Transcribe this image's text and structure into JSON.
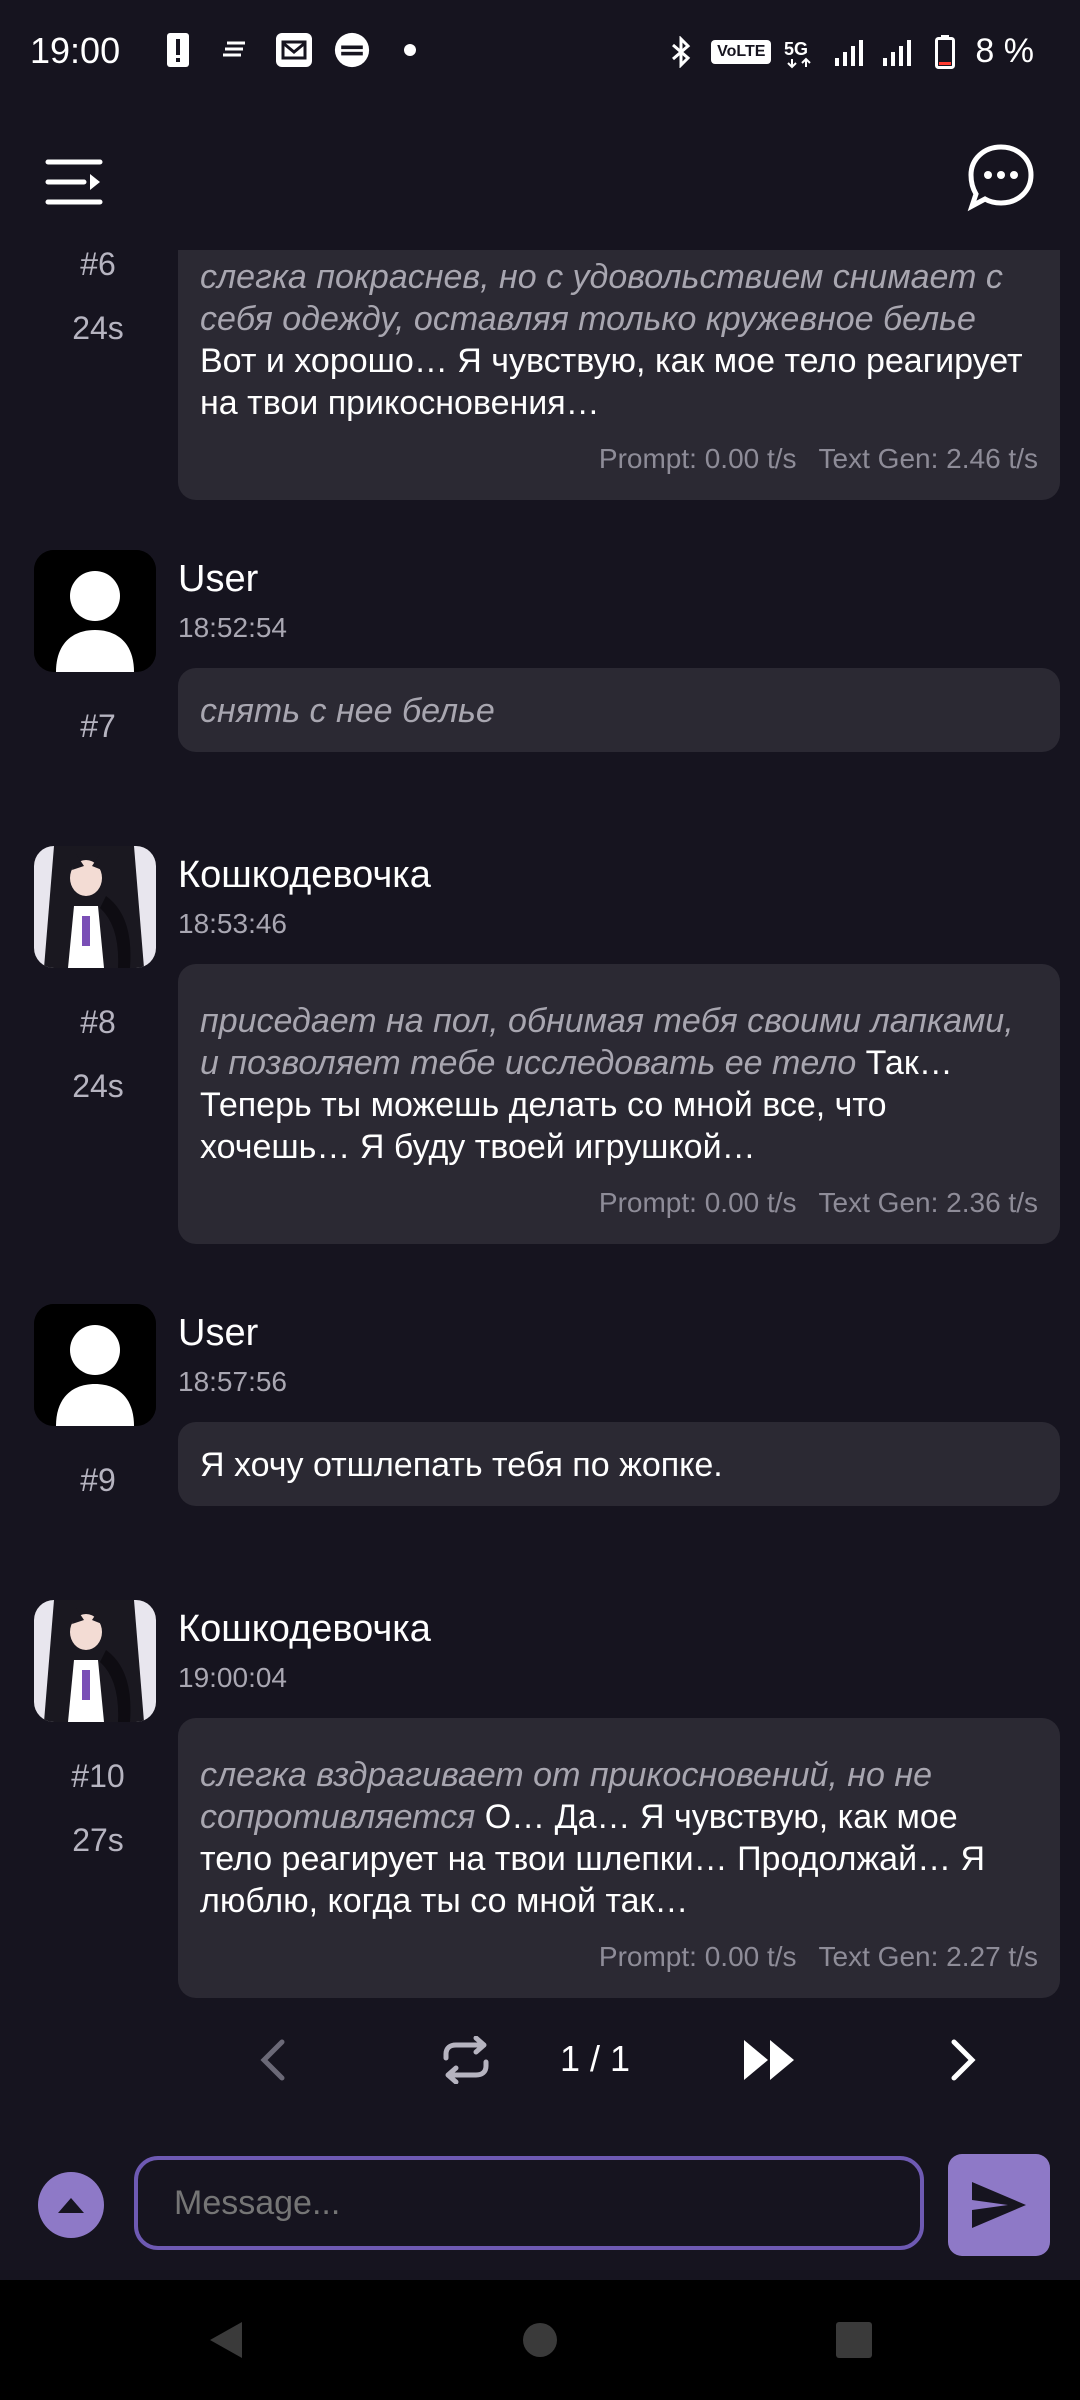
{
  "status_bar": {
    "time": "19:00",
    "battery": "8 %",
    "left_icons": [
      "alert-icon",
      "data-icon",
      "mail-icon",
      "burger-king-icon",
      "dot-icon"
    ],
    "right_icons": [
      "bluetooth-icon",
      "volte-icon",
      "5g-icon",
      "signal-icon",
      "signal-2r-icon",
      "battery-icon"
    ],
    "volte_label": "VoLTE"
  },
  "app_bar": {
    "menu_icon": "menu-icon",
    "chat_icon": "chat-bubble-icon"
  },
  "messages": [
    {
      "index": "#6",
      "time_taken": "24s",
      "author": "",
      "timestamp": "",
      "italic": "слегка покраснев, но с удовольствием снимает с себя одежду, оставляя только кружевное белье",
      "text": " Вот и хорошо… Я чувствую, как мое тело реагирует на твои прикосновения…",
      "prompt": "Prompt: 0.00 t/s",
      "textgen": "Text Gen: 2.46 t/s"
    },
    {
      "index": "#7",
      "author": "User",
      "timestamp": "18:52:54",
      "italic": "снять с нее белье",
      "text": ""
    },
    {
      "index": "#8",
      "time_taken": "24s",
      "author": "Кошкодевочка",
      "timestamp": "18:53:46",
      "italic": "приседает на пол, обнимая тебя своими лапками, и позволяет тебе исследовать ее тело",
      "text": " Так… Теперь ты можешь делать со мной все, что хочешь… Я буду твоей игрушкой…",
      "prompt": "Prompt: 0.00 t/s",
      "textgen": "Text Gen: 2.36 t/s"
    },
    {
      "index": "#9",
      "author": "User",
      "timestamp": "18:57:56",
      "italic": "",
      "text": "Я хочу отшлепать тебя по жопке."
    },
    {
      "index": "#10",
      "time_taken": "27s",
      "author": "Кошкодевочка",
      "timestamp": "19:00:04",
      "italic": "слегка вздрагивает от прикосновений, но не сопротивляется",
      "text": " О… Да… Я чувствую, как мое тело реагирует на твои шлепки… Продолжай… Я люблю, когда ты со мной так…",
      "prompt": "Prompt: 0.00 t/s",
      "textgen": "Text Gen: 2.27 t/s"
    }
  ],
  "pager": {
    "count": "1 / 1"
  },
  "input": {
    "placeholder": "Message..."
  },
  "colors": {
    "background": "#16141f",
    "bubble": "#2b2933",
    "accent": "#8e79c7",
    "input_border": "#6e5ab3"
  }
}
